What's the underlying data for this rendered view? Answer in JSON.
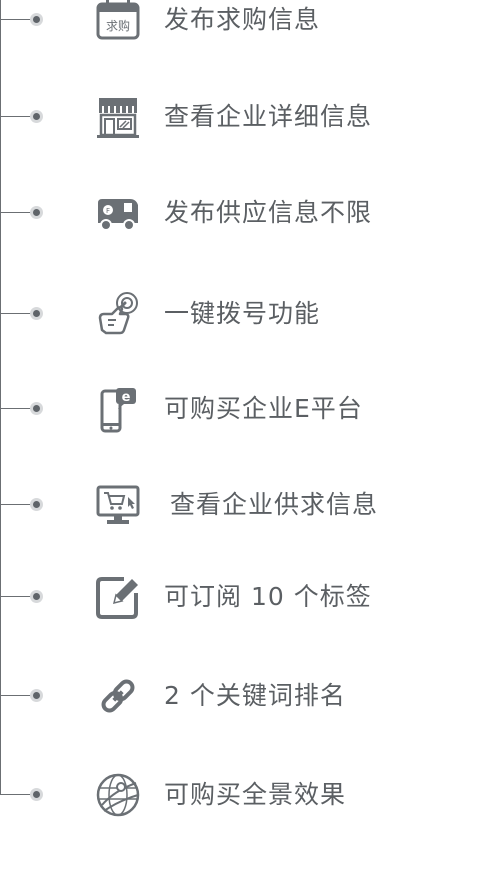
{
  "features": [
    {
      "label": "发布求购信息",
      "icon": "purchase-calendar-icon",
      "icon_text": "求购"
    },
    {
      "label": "查看企业详细信息",
      "icon": "storefront-icon"
    },
    {
      "label": "发布供应信息不限",
      "icon": "delivery-truck-icon"
    },
    {
      "label": "一键拨号功能",
      "icon": "tap-phone-icon"
    },
    {
      "label": "可购买企业E平台",
      "icon": "mobile-e-icon"
    },
    {
      "label": "查看企业供求信息",
      "icon": "computer-cart-icon"
    },
    {
      "label": "可订阅 10 个标签",
      "icon": "edit-note-icon"
    },
    {
      "label": "2 个关键词排名",
      "icon": "link-chain-icon"
    },
    {
      "label": "可购买全景效果",
      "icon": "globe-panorama-icon"
    }
  ],
  "colors": {
    "line": "#6b6f73",
    "icon": "#6b7075",
    "text": "#5b5f63",
    "node_outer": "#d7d9db",
    "node_inner": "#5f6469"
  }
}
